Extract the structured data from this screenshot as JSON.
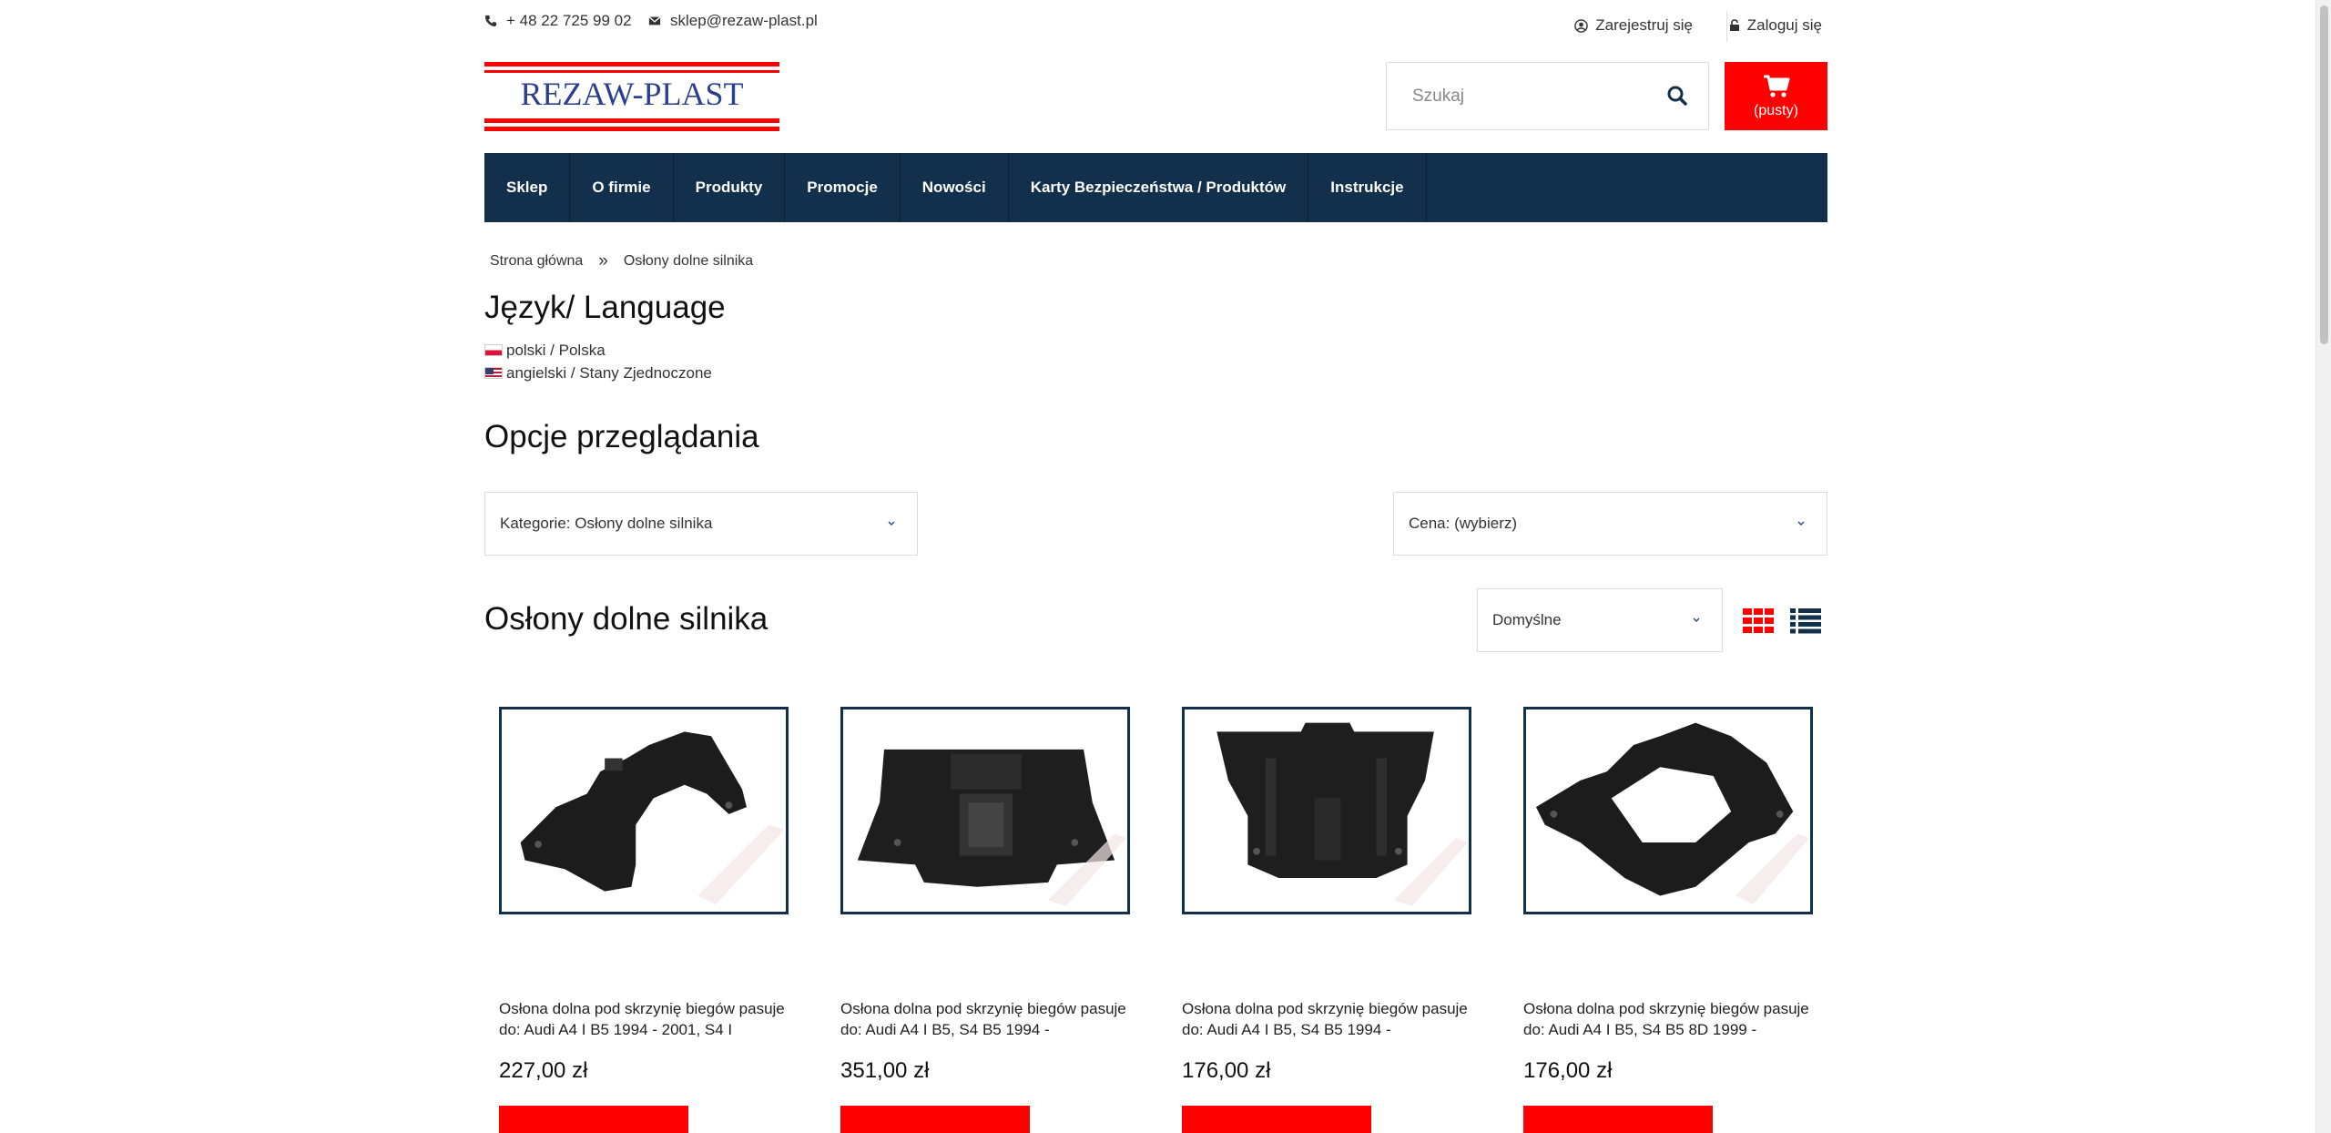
{
  "topbar": {
    "phone": "+ 48 22 725 99 02",
    "email": "sklep@rezaw-plast.pl",
    "register": "Zarejestruj się",
    "login": "Zaloguj się"
  },
  "header": {
    "logo_text": "REZAW-PLAST",
    "search_placeholder": "Szukaj",
    "cart_label": "(pusty)",
    "colors": {
      "accent": "#ff0000",
      "nav": "#12304c",
      "logo_blue": "#2b3f8f"
    }
  },
  "nav": {
    "items": [
      {
        "label": "Sklep"
      },
      {
        "label": "O firmie"
      },
      {
        "label": "Produkty"
      },
      {
        "label": "Promocje"
      },
      {
        "label": "Nowości"
      },
      {
        "label": "Karty Bezpieczeństwa / Produktów"
      },
      {
        "label": "Instrukcje"
      }
    ]
  },
  "breadcrumb": {
    "home": "Strona główna",
    "separator": "»",
    "current": "Osłony dolne silnika"
  },
  "language": {
    "title": "Język/ Language",
    "options": [
      {
        "label": "polski / Polska",
        "flag": "pl-flag"
      },
      {
        "label": "angielski / Stany Zjednoczone",
        "flag": "us-flag"
      }
    ]
  },
  "browse": {
    "title": "Opcje przeglądania",
    "category_select": "Kategorie: Osłony dolne silnika",
    "price_select": "Cena: (wybierz)"
  },
  "listing": {
    "title": "Osłony dolne silnika",
    "sort_select": "Domyślne",
    "view_icons": [
      "grid-view-icon",
      "list-view-icon"
    ]
  },
  "products": [
    {
      "name": "Osłona dolna pod skrzynię biegów pasuje do: Audi A4 I B5 1994 - 2001, S4 I",
      "price": "227,00 zł"
    },
    {
      "name": "Osłona dolna pod skrzynię biegów pasuje do: Audi A4 I B5, S4 B5 1994 -",
      "price": "351,00 zł"
    },
    {
      "name": "Osłona dolna pod skrzynię biegów pasuje do: Audi A4 I B5, S4 B5 1994 -",
      "price": "176,00 zł"
    },
    {
      "name": "Osłona dolna pod skrzynię biegów pasuje do: Audi A4 I B5, S4 B5 8D 1999 -",
      "price": "176,00 zł"
    }
  ]
}
